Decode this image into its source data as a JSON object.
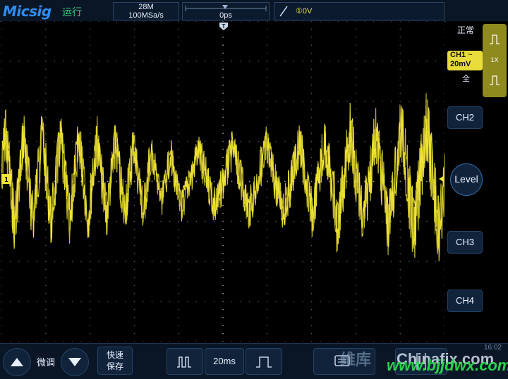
{
  "header": {
    "logo": "Micsig",
    "run_status": "运行",
    "memory_depth": "28M",
    "sample_rate": "100MSa/s",
    "horizontal_position": "0ps",
    "trigger_slope_icon": "rising-edge-icon",
    "trigger_level": "①0V"
  },
  "side": {
    "trigger_mode": "正常",
    "ch1_label": "CH1",
    "ch1_scale": "20mV",
    "ch1_coupling_symbol": "~",
    "ch1_bandwidth": "全",
    "probe_factor": "1X",
    "ch2": "CH2",
    "level": "Level",
    "ch3": "CH3",
    "ch4": "CH4"
  },
  "bottom": {
    "fine_tune": "微调",
    "quick_save_line1": "快速",
    "quick_save_line2": "保存",
    "timebase": "20ms",
    "clock": "16:02"
  },
  "watermark": {
    "brand": "维库",
    "site": "Chinafix.com",
    "url": "www.bjjdwx.com"
  },
  "colors": {
    "trace": "#f2e636",
    "accent": "#2f8cf0",
    "run": "#35d07f"
  }
}
